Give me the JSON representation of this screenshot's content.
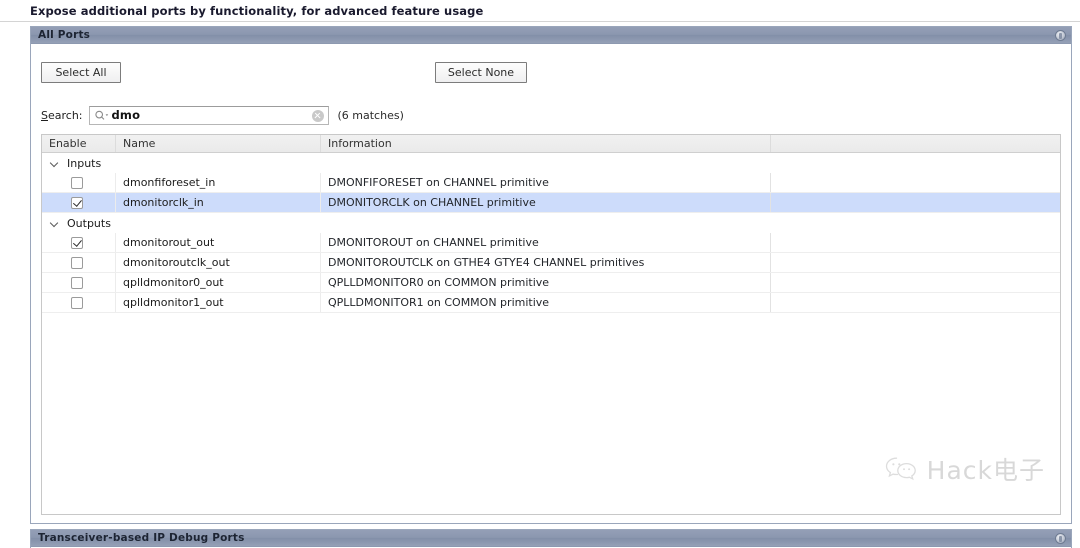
{
  "page": {
    "heading": "Expose additional ports by functionality, for advanced feature usage"
  },
  "all_ports_panel": {
    "title": "All Ports",
    "help_icon": "help-icon",
    "buttons": {
      "select_all": "Select All",
      "select_none": "Select None"
    },
    "search": {
      "label_prefix": "S",
      "label_rest": "earch:",
      "value": "dmo",
      "placeholder": "",
      "search_icon": "search-icon",
      "clear_icon": "clear-icon",
      "matches": "(6 matches)"
    },
    "table": {
      "columns": [
        "Enable",
        "Name",
        "Information",
        ""
      ],
      "groups": [
        {
          "label": "Inputs",
          "expanded": true,
          "rows": [
            {
              "checked": false,
              "selected": false,
              "name": "dmonfiforeset_in",
              "information": "DMONFIFORESET on CHANNEL primitive"
            },
            {
              "checked": true,
              "selected": true,
              "name": "dmonitorclk_in",
              "information": "DMONITORCLK on CHANNEL primitive"
            }
          ]
        },
        {
          "label": "Outputs",
          "expanded": true,
          "rows": [
            {
              "checked": true,
              "selected": false,
              "name": "dmonitorout_out",
              "information": "DMONITOROUT on CHANNEL primitive"
            },
            {
              "checked": false,
              "selected": false,
              "name": "dmonitoroutclk_out",
              "information": "DMONITOROUTCLK on GTHE4 GTYE4 CHANNEL primitives"
            },
            {
              "checked": false,
              "selected": false,
              "name": "qplldmonitor0_out",
              "information": "QPLLDMONITOR0 on COMMON primitive"
            },
            {
              "checked": false,
              "selected": false,
              "name": "qplldmonitor1_out",
              "information": "QPLLDMONITOR1 on COMMON primitive"
            }
          ]
        }
      ]
    }
  },
  "debug_ports_panel": {
    "title": "Transceiver-based IP Debug Ports",
    "help_icon": "help-icon"
  },
  "watermark": {
    "text": "Hack电子",
    "logo": "wechat-logo"
  },
  "colors": {
    "titlebar": "#8b97af",
    "selection": "#cddcfb",
    "header_row": "#eaeaea",
    "panel_border": "#9aa6bb"
  }
}
